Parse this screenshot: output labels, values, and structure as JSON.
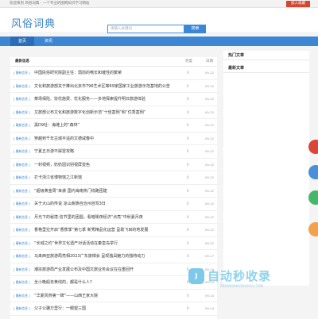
{
  "topbar": {
    "text": "欢迎来到 风俗词典 - 一个专业的图网知识学习网站",
    "login": "加入收藏"
  },
  "header": {
    "logo": "风俗词典",
    "search_placeholder": "请输入关键词",
    "search_button": "搜索"
  },
  "nav": {
    "tabs": [
      "首页",
      "资讯"
    ]
  },
  "main": {
    "title": "最新信息",
    "col_hot": "热度",
    "col_date": "日期",
    "rows": [
      {
        "tag": "[ 最新信息 ]",
        "title": "中国民俗研究院副主任：弱前的嗜长和璀性的繁荣",
        "hot": "0",
        "date": "09-22"
      },
      {
        "tag": "[ 最新信息 ]",
        "title": "文化和旅游部关于推出北京市796艺术区等69家国家工业旅游示范基地的公告",
        "hot": "0",
        "date": "09-22"
      },
      {
        "tag": "[ 最新信息 ]",
        "title": "菜场保险、协优施费、优化服务——多地探索提升明日旅游体验",
        "hot": "0",
        "date": "09-22"
      },
      {
        "tag": "[ 最新信息 ]",
        "title": "文旅部公布文化和旅游数字化创新示范“十佳案例”和“优秀案例”",
        "hot": "0",
        "date": "09-22"
      },
      {
        "tag": "[ 最新信息 ]",
        "title": "黑D9社：海滩上的“森林”",
        "hot": "0",
        "date": "09-22"
      },
      {
        "tag": "[ 最新信息 ]",
        "title": "穿越到千年古城平遥的文德咸春中",
        "hot": "0",
        "date": "09-22"
      },
      {
        "tag": "[ 最新信息 ]",
        "title": "宁夏五日游不踩雷攻略",
        "hot": "0",
        "date": "09-22"
      },
      {
        "tag": "[ 最新信息 ]",
        "title": "一封视频，奶奶因识别视屏蛮色",
        "hot": "0",
        "date": "09-22"
      },
      {
        "tag": "[ 最新信息 ]",
        "title": "打卡浙江省博物馆之江新馆",
        "hot": "0",
        "date": "09-22"
      },
      {
        "tag": "[ 最新信息 ]",
        "title": "“超级黄金周”来袭 国内海南热门线路团建",
        "hot": "0",
        "date": "09-22"
      },
      {
        "tag": "[ 最新信息 ]",
        "title": "关于大山的传说 凉山彝族自治州自驾3日",
        "hot": "0",
        "date": "09-22"
      },
      {
        "tag": "[ 最新信息 ]",
        "title": "月光下的秘境·信节里的团圆，看璀璨夜经济“点亮”中秋夏月夜",
        "hot": "0",
        "date": "09-22"
      },
      {
        "tag": "[ 最新信息 ]",
        "title": "香格里拉开启“香蕉季”第七季 新秀精品化运营 呈助飞目的地发展",
        "hot": "0",
        "date": "09-22"
      },
      {
        "tag": "[ 最新信息 ]",
        "title": "“长城之约”世界文化遗产对话活动在秦皇岛举行",
        "hot": "0",
        "date": "09-22"
      },
      {
        "tag": "[ 最新信息 ]",
        "title": "马来西亚旅游局亮相2023广东旅博会 呈现独具魅力的独特动力",
        "hot": "0",
        "date": "09-17"
      },
      {
        "tag": "[ 最新信息 ]",
        "title": "潮宗旅游局产业发展公布及中国文旅业务会议在在重回开",
        "hot": "0",
        "date": "09-14"
      },
      {
        "tag": "[ 最新信息 ]",
        "title": "全小晚船去黄线的，都是什么人?",
        "hot": "0",
        "date": "09-14"
      },
      {
        "tag": "[ 最新信息 ]",
        "title": "“华夏风骨第一碑”——山西王家大院",
        "hot": "0",
        "date": "09-14"
      },
      {
        "tag": "[ 最新信息 ]",
        "title": "父子公骥万里行：一眼望三国",
        "hot": "0",
        "date": "09-14"
      }
    ]
  },
  "sidebar": {
    "hot_title": "热门文章",
    "new_title": "最新文章"
  },
  "watermark": {
    "main": "自动秒收录",
    "sub": "ZIDONGMIAOSHOULU.COM"
  }
}
